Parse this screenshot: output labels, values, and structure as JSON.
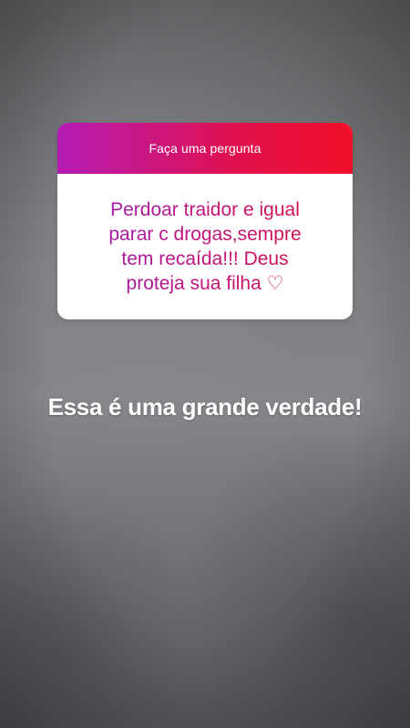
{
  "story": {
    "question_box": {
      "header": "Faça uma pergunta",
      "answer": "Perdoar traidor e igual\nparar c drogas,sempre\ntem recaída!!! Deus\nproteja sua filha ♡"
    },
    "caption": "Essa é uma grande verdade!"
  },
  "colors": {
    "header_gradient_start": "#b41bb5",
    "header_gradient_end": "#f2102a",
    "answer_text": "#c2147c",
    "caption_text": "#ffffff"
  }
}
